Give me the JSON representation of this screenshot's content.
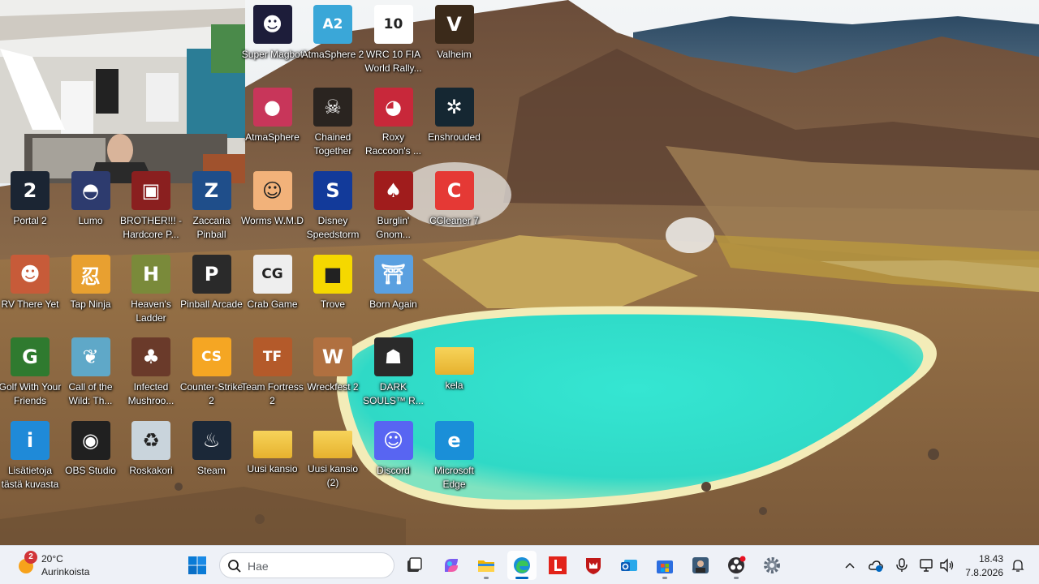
{
  "desktop": {
    "icons": [
      {
        "label": "Super Magbot",
        "icon": "super-magbot-icon",
        "color": "#1d1d3a",
        "glyph": "☻",
        "col": 4,
        "row": 0
      },
      {
        "label": "AtmaSphere 2",
        "icon": "atmasphere2-icon",
        "color": "#3aa7d8",
        "glyph": "A2",
        "col": 5,
        "row": 0
      },
      {
        "label": "WRC 10 FIA World Rally...",
        "icon": "wrc10-icon",
        "color": "#ffffff",
        "glyph": "10",
        "col": 6,
        "row": 0
      },
      {
        "label": "Valheim",
        "icon": "valheim-icon",
        "color": "#3b2a1a",
        "glyph": "V",
        "col": 7,
        "row": 0
      },
      {
        "label": "AtmaSphere",
        "icon": "atmasphere-icon",
        "color": "#c8365a",
        "glyph": "●",
        "col": 4,
        "row": 1
      },
      {
        "label": "Chained Together",
        "icon": "chained-together-icon",
        "color": "#2a2420",
        "glyph": "☠",
        "col": 5,
        "row": 1
      },
      {
        "label": "Roxy Raccoon's ...",
        "icon": "roxy-raccoon-icon",
        "color": "#c8283a",
        "glyph": "◕",
        "col": 6,
        "row": 1
      },
      {
        "label": "Enshrouded",
        "icon": "enshrouded-icon",
        "color": "#152732",
        "glyph": "✲",
        "col": 7,
        "row": 1
      },
      {
        "label": "Portal 2",
        "icon": "portal2-icon",
        "color": "#1b2533",
        "glyph": "2",
        "col": 0,
        "row": 2
      },
      {
        "label": "Lumo",
        "icon": "lumo-icon",
        "color": "#2d3b6e",
        "glyph": "◓",
        "col": 1,
        "row": 2
      },
      {
        "label": "BROTHER!!! - Hardcore P...",
        "icon": "brother-icon",
        "color": "#8a1f1f",
        "glyph": "▣",
        "col": 2,
        "row": 2
      },
      {
        "label": "Zaccaria Pinball",
        "icon": "zaccaria-pinball-icon",
        "color": "#1f4e8a",
        "glyph": "Z",
        "col": 3,
        "row": 2
      },
      {
        "label": "Worms W.M.D",
        "icon": "worms-wmd-icon",
        "color": "#f2b27a",
        "glyph": "☺",
        "col": 4,
        "row": 2
      },
      {
        "label": "Disney Speedstorm",
        "icon": "disney-speedstorm-icon",
        "color": "#123a9a",
        "glyph": "S",
        "col": 5,
        "row": 2
      },
      {
        "label": "Burglin' Gnom...",
        "icon": "burglin-gnomes-icon",
        "color": "#a01c1c",
        "glyph": "♠",
        "col": 6,
        "row": 2
      },
      {
        "label": "CCleaner 7",
        "icon": "ccleaner-icon",
        "color": "#e53935",
        "glyph": "C",
        "col": 7,
        "row": 2
      },
      {
        "label": "RV There Yet",
        "icon": "rv-there-yet-icon",
        "color": "#c75b39",
        "glyph": "☻",
        "col": 0,
        "row": 3
      },
      {
        "label": "Tap Ninja",
        "icon": "tap-ninja-icon",
        "color": "#e8a030",
        "glyph": "忍",
        "col": 1,
        "row": 3
      },
      {
        "label": "Heaven's Ladder",
        "icon": "heavens-ladder-icon",
        "color": "#7a8a3a",
        "glyph": "H",
        "col": 2,
        "row": 3
      },
      {
        "label": "Pinball Arcade",
        "icon": "pinball-arcade-icon",
        "color": "#2a2a2a",
        "glyph": "P",
        "col": 3,
        "row": 3
      },
      {
        "label": "Crab Game",
        "icon": "crab-game-icon",
        "color": "#eeeeee",
        "glyph": "CG",
        "col": 4,
        "row": 3
      },
      {
        "label": "Trove",
        "icon": "trove-icon",
        "color": "#f5d800",
        "glyph": "■",
        "col": 5,
        "row": 3
      },
      {
        "label": "Born Again",
        "icon": "born-again-icon",
        "color": "#5aa0e0",
        "glyph": "⛩",
        "col": 6,
        "row": 3
      },
      {
        "label": "Golf With Your Friends",
        "icon": "golf-with-friends-icon",
        "color": "#2f7a2f",
        "glyph": "G",
        "col": 0,
        "row": 4
      },
      {
        "label": "Call of the Wild: Th...",
        "icon": "call-of-the-wild-icon",
        "color": "#5fa8c8",
        "glyph": "❦",
        "col": 1,
        "row": 4
      },
      {
        "label": "Infected Mushroo...",
        "icon": "infected-mushroom-icon",
        "color": "#6a3a2a",
        "glyph": "♣",
        "col": 2,
        "row": 4
      },
      {
        "label": "Counter-Strike 2",
        "icon": "counter-strike-icon",
        "color": "#f5a623",
        "glyph": "CS",
        "col": 3,
        "row": 4
      },
      {
        "label": "Team Fortress 2",
        "icon": "team-fortress-icon",
        "color": "#b45a2a",
        "glyph": "TF",
        "col": 4,
        "row": 4
      },
      {
        "label": "Wreckfest 2",
        "icon": "wreckfest2-icon",
        "color": "#b07040",
        "glyph": "W",
        "col": 5,
        "row": 4
      },
      {
        "label": "DARK SOULS™ R...",
        "icon": "dark-souls-icon",
        "color": "#2a2a2a",
        "glyph": "☗",
        "col": 6,
        "row": 4
      },
      {
        "label": "kela",
        "icon": "folder-icon",
        "color": "#f4c64a",
        "glyph": "",
        "col": 7,
        "row": 4
      },
      {
        "label": "Lisätietoja tästä kuvasta",
        "icon": "info-picture-icon",
        "color": "#1f8ad8",
        "glyph": "i",
        "col": 0,
        "row": 5
      },
      {
        "label": "OBS Studio",
        "icon": "obs-studio-icon",
        "color": "#202020",
        "glyph": "◉",
        "col": 1,
        "row": 5
      },
      {
        "label": "Roskakori",
        "icon": "recycle-bin-icon",
        "color": "#c9d4dc",
        "glyph": "♻",
        "col": 2,
        "row": 5
      },
      {
        "label": "Steam",
        "icon": "steam-icon",
        "color": "#1b2838",
        "glyph": "♨",
        "col": 3,
        "row": 5
      },
      {
        "label": "Uusi kansio",
        "icon": "folder-icon",
        "color": "#f4c64a",
        "glyph": "",
        "col": 4,
        "row": 5
      },
      {
        "label": "Uusi kansio (2)",
        "icon": "folder-icon",
        "color": "#f4c64a",
        "glyph": "",
        "col": 5,
        "row": 5
      },
      {
        "label": "Discord",
        "icon": "discord-icon",
        "color": "#5865f2",
        "glyph": "☺",
        "col": 6,
        "row": 5
      },
      {
        "label": "Microsoft Edge",
        "icon": "edge-icon",
        "color": "#1a8fd8",
        "glyph": "e",
        "col": 7,
        "row": 5
      }
    ]
  },
  "taskbar": {
    "weather": {
      "temp": "20°C",
      "condition": "Aurinkoista",
      "badge": "2"
    },
    "search_placeholder": "Hae",
    "clock": {
      "time": "18.43",
      "date": "7.8.2026"
    }
  },
  "colors": {
    "taskbar_bg": "#eef1f7",
    "accent": "#0067c0",
    "lake": "#3fe3d0",
    "sky": "#dfe8ee"
  }
}
